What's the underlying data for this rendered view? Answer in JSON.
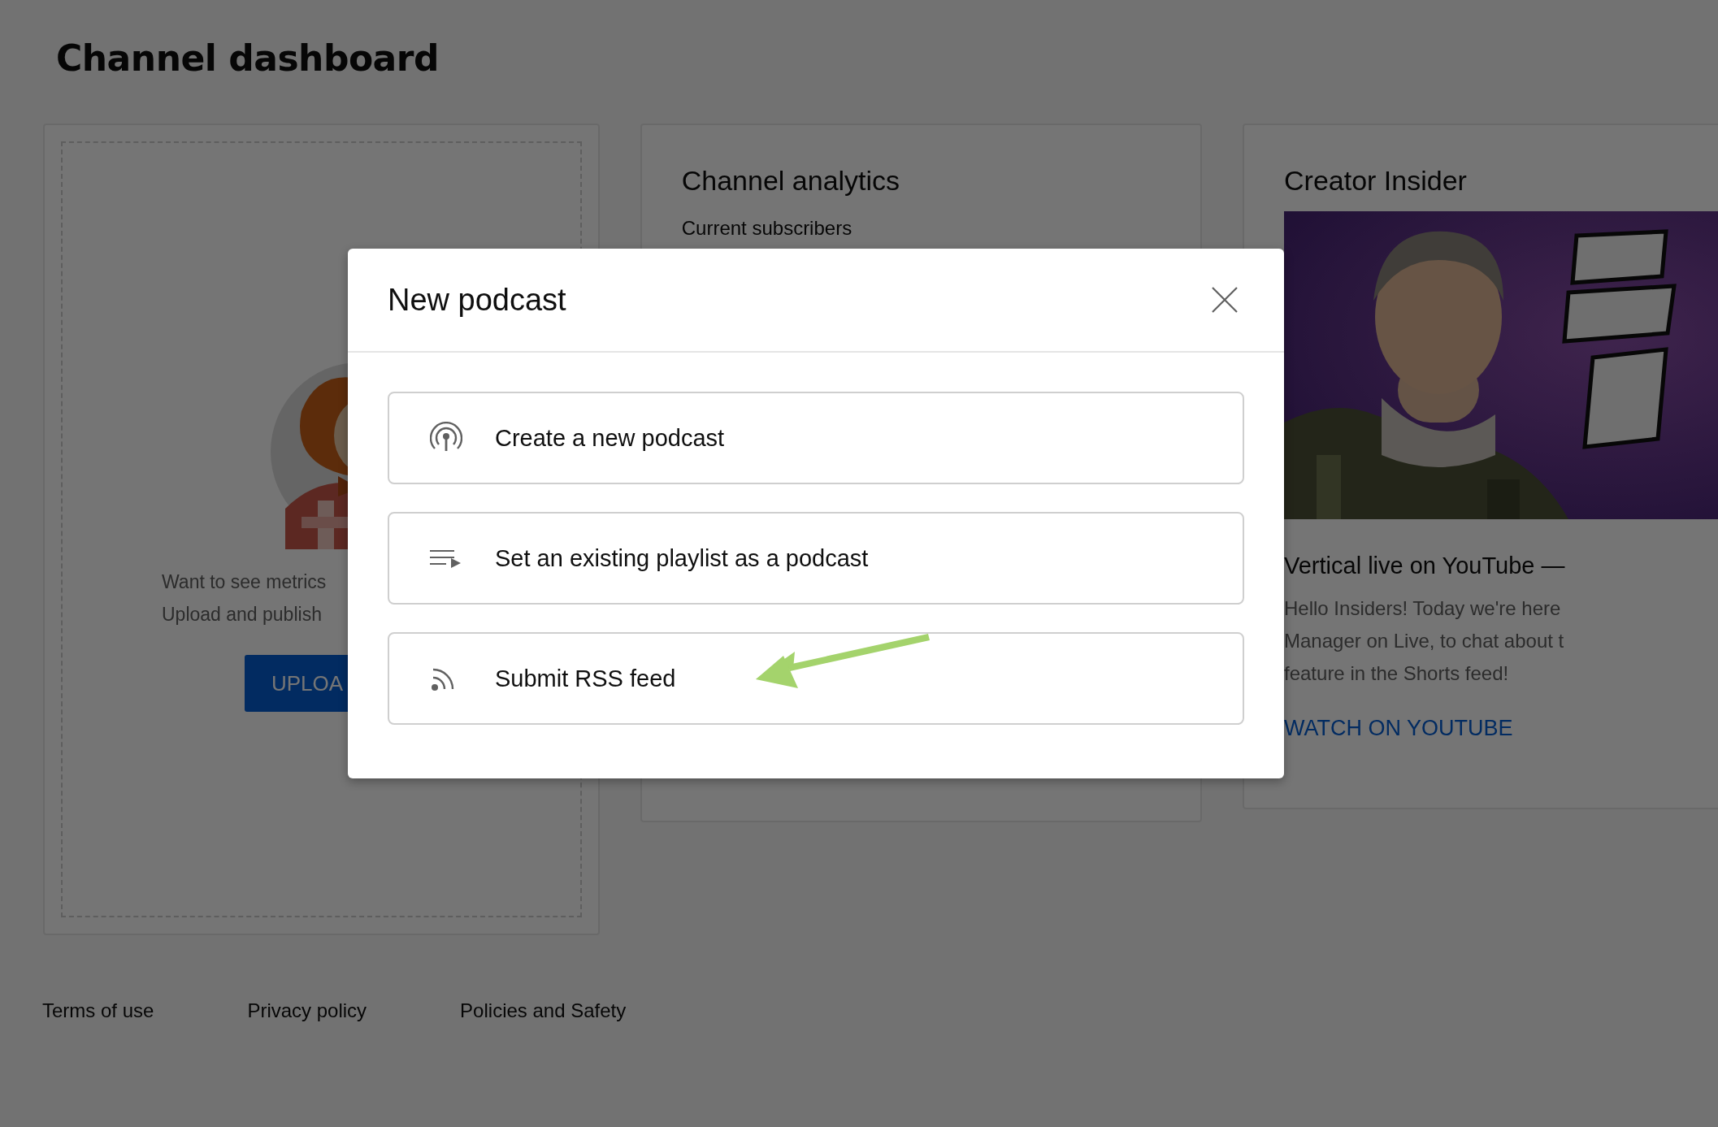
{
  "page": {
    "title": "Channel dashboard"
  },
  "upload_card": {
    "message_lines": [
      "Want to see metrics",
      "Upload and publish"
    ],
    "button": "UPLOA"
  },
  "analytics_card": {
    "title": "Channel analytics",
    "subtitle": "Current subscribers"
  },
  "insider_card": {
    "title": "Creator Insider",
    "video_title": "Vertical live on YouTube —",
    "description_lines": [
      "Hello Insiders! Today we're here",
      "Manager on Live, to chat about t",
      "feature in the Shorts feed!"
    ],
    "link": "WATCH ON YOUTUBE"
  },
  "footer_links": [
    "Terms of use",
    "Privacy policy",
    "Policies and Safety"
  ],
  "dialog": {
    "title": "New podcast",
    "options": [
      {
        "kind": "podcast",
        "label": "Create a new podcast"
      },
      {
        "kind": "playlist",
        "label": "Set an existing playlist as a podcast"
      },
      {
        "kind": "rss",
        "label": "Submit RSS feed"
      }
    ]
  }
}
